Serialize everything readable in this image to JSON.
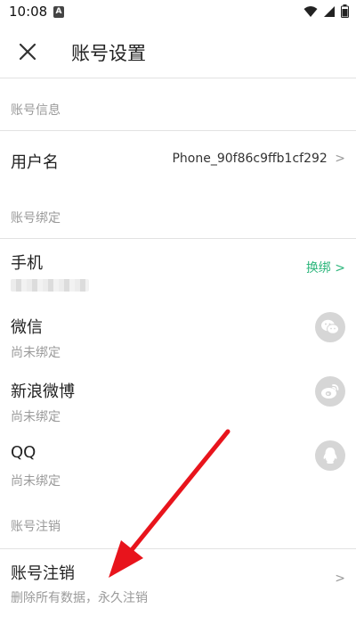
{
  "status_bar": {
    "time": "10:08",
    "notification_icon": "A"
  },
  "app_bar": {
    "title": "账号设置"
  },
  "sections": {
    "account_info": "账号信息",
    "account_binding": "账号绑定",
    "account_cancel": "账号注销"
  },
  "username": {
    "label": "用户名",
    "value": "Phone_90f86c9ffb1cf292",
    "chevron": ">"
  },
  "phone": {
    "label": "手机",
    "action": "换绑 >"
  },
  "wechat": {
    "label": "微信",
    "status": "尚未绑定"
  },
  "weibo": {
    "label": "新浪微博",
    "status": "尚未绑定"
  },
  "qq": {
    "label": "QQ",
    "status": "尚未绑定"
  },
  "cancel": {
    "label": "账号注销",
    "desc": "删除所有数据，永久注销",
    "chevron": ">"
  },
  "colors": {
    "accent_green": "#2db67c",
    "annotation_arrow": "#e8141c",
    "icon_bg": "#d6d6d6"
  },
  "icons": [
    "close-icon",
    "wifi-icon",
    "signal-icon",
    "battery-icon",
    "wechat-icon",
    "weibo-icon",
    "qq-icon"
  ]
}
